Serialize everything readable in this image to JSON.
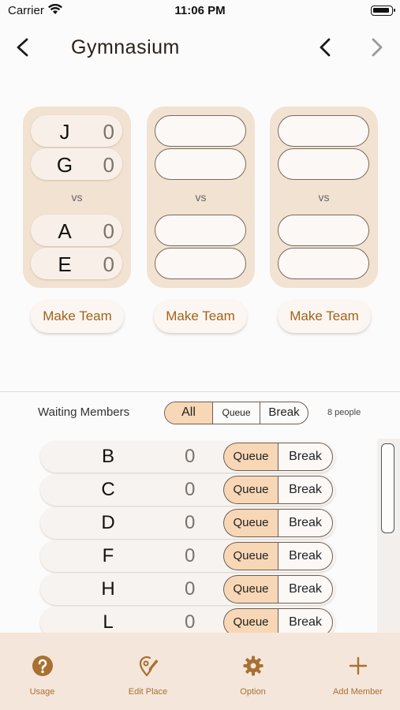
{
  "status_bar": {
    "carrier": "Carrier",
    "time": "11:06 PM"
  },
  "nav": {
    "title": "Gymnasium",
    "back_icon": "chevron-left-icon",
    "prev_icon": "chevron-left-icon",
    "next_icon": "chevron-right-icon"
  },
  "courts": [
    {
      "team1": [
        {
          "name": "J",
          "score": "0"
        },
        {
          "name": "G",
          "score": "0"
        }
      ],
      "vs": "vs",
      "team2": [
        {
          "name": "A",
          "score": "0"
        },
        {
          "name": "E",
          "score": "0"
        }
      ],
      "button": "Make Team"
    },
    {
      "vs": "vs",
      "button": "Make Team"
    },
    {
      "vs": "vs",
      "button": "Make Team"
    }
  ],
  "waiting": {
    "label": "Waiting Members",
    "filter": {
      "options": [
        "All",
        "Queue",
        "Break"
      ],
      "selected": "All"
    },
    "count": "8 people",
    "rows": [
      {
        "name": "B",
        "score": "0",
        "queue": "Queue",
        "break": "Break"
      },
      {
        "name": "C",
        "score": "0",
        "queue": "Queue",
        "break": "Break"
      },
      {
        "name": "D",
        "score": "0",
        "queue": "Queue",
        "break": "Break"
      },
      {
        "name": "F",
        "score": "0",
        "queue": "Queue",
        "break": "Break"
      },
      {
        "name": "H",
        "score": "0",
        "queue": "Queue",
        "break": "Break"
      },
      {
        "name": "L",
        "score": "0",
        "queue": "Queue",
        "break": "Break"
      }
    ]
  },
  "tabbar": [
    {
      "label": "Usage",
      "icon": "question-circle-icon"
    },
    {
      "label": "Edit Place",
      "icon": "pin-edit-icon"
    },
    {
      "label": "Option",
      "icon": "gear-icon"
    },
    {
      "label": "Add Member",
      "icon": "plus-icon"
    }
  ],
  "colors": {
    "accent": "#a97032",
    "court_bg": "#f2e2d2",
    "selected": "#f8d7b6",
    "tabbar_bg": "#f4e6da"
  }
}
